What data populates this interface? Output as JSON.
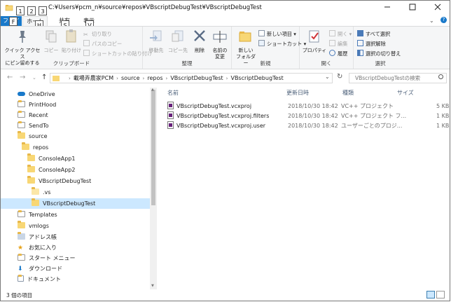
{
  "window": {
    "title": "C:¥Users¥pcm_n¥source¥repos¥VBscriptDebugTest¥VBscriptDebugTest",
    "keytips": [
      "1",
      "2",
      "3"
    ]
  },
  "tabs": {
    "file": "ファイル",
    "file_keytip": "F",
    "home": "ホーム",
    "home_keytip": "H",
    "share": "共有",
    "share_keytip": "S",
    "view": "表示",
    "view_keytip": "V"
  },
  "ribbon": {
    "clipboard": {
      "label": "クリップボード",
      "pin": "クイック アクセス\nにピン留めする",
      "copy": "コピー",
      "paste": "貼り付け",
      "cut": "切り取り",
      "copy_path": "パスのコピー",
      "paste_shortcut": "ショートカットの貼り付け"
    },
    "organize": {
      "label": "整理",
      "move_to": "移動先",
      "copy_to": "コピー先",
      "delete": "削除",
      "rename": "名前の\n変更"
    },
    "new": {
      "label": "新規",
      "new_folder": "新しい\nフォルダー",
      "new_item": "新しい項目 ▾",
      "shortcut": "ショートカット ▾"
    },
    "open": {
      "label": "開く",
      "properties": "プロパティ",
      "open": "開く ▾",
      "edit": "編集",
      "history": "履歴"
    },
    "select": {
      "label": "選択",
      "select_all": "すべて選択",
      "select_none": "選択解除",
      "invert": "選択の切り替え"
    }
  },
  "address": {
    "crumbs": [
      "載場弄農家PCM",
      "source",
      "repos",
      "VBscriptDebugTest",
      "VBscriptDebugTest"
    ],
    "search_placeholder": "VBscriptDebugTestの検索"
  },
  "navpane": {
    "items": [
      {
        "label": "OneDrive",
        "icon": "cloud-icon"
      },
      {
        "label": "PrintHood",
        "icon": "shortcut-icon"
      },
      {
        "label": "Recent",
        "icon": "shortcut-icon"
      },
      {
        "label": "SendTo",
        "icon": "shortcut-icon"
      },
      {
        "label": "source",
        "icon": "folder-icon"
      },
      {
        "label": "repos",
        "icon": "folder-icon"
      },
      {
        "label": "ConsoleApp1",
        "icon": "folder-icon"
      },
      {
        "label": "ConsoleApp2",
        "icon": "folder-icon"
      },
      {
        "label": "VBscriptDebugTest",
        "icon": "folder-icon"
      },
      {
        "label": ".vs",
        "icon": "folder-icon"
      },
      {
        "label": "VBscriptDebugTest",
        "icon": "folder-icon"
      },
      {
        "label": "Templates",
        "icon": "shortcut-icon"
      },
      {
        "label": "vmlogs",
        "icon": "folder-icon"
      },
      {
        "label": "アドレス帳",
        "icon": "contacts-icon"
      },
      {
        "label": "お気に入り",
        "icon": "star-icon"
      },
      {
        "label": "スタート メニュー",
        "icon": "shortcut-icon"
      },
      {
        "label": "ダウンロード",
        "icon": "download-icon"
      },
      {
        "label": "ドキュメント",
        "icon": "document-icon"
      }
    ]
  },
  "columns": {
    "name": "名前",
    "date": "更新日時",
    "type": "種類",
    "size": "サイズ"
  },
  "files": [
    {
      "name": "VBscriptDebugTest.vcxproj",
      "date": "2018/10/30 18:42",
      "type": "VC++ プロジェクト",
      "size": "5 KB"
    },
    {
      "name": "VBscriptDebugTest.vcxproj.filters",
      "date": "2018/10/30 18:42",
      "type": "VC++ プロジェクト フ...",
      "size": "1 KB"
    },
    {
      "name": "VBscriptDebugTest.vcxproj.user",
      "date": "2018/10/30 18:42",
      "type": "ユーザーごとのプロジ...",
      "size": "1 KB"
    }
  ],
  "status": {
    "count": "3 個の項目"
  },
  "colors": {
    "accent": "#1979ca",
    "selection": "#cce8ff",
    "folder": "#f8d775"
  }
}
